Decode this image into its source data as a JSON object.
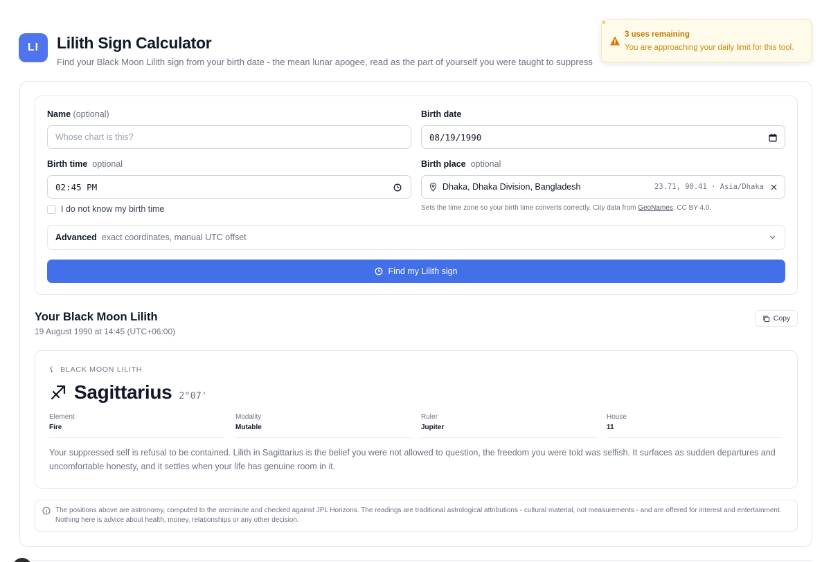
{
  "header": {
    "logo_text": "LI",
    "title": "Lilith Sign Calculator",
    "subtitle": "Find your Black Moon Lilith sign from your birth date - the mean lunar apogee, read as the part of yourself you were taught to suppress"
  },
  "toast": {
    "close": "×",
    "title": "3 uses remaining",
    "message": "You are approaching your daily limit for this tool.",
    "accent": "#d97706"
  },
  "form": {
    "name": {
      "label": "Name",
      "optional": "(optional)",
      "placeholder": "Whose chart is this?",
      "value": ""
    },
    "birth_date": {
      "label": "Birth date",
      "value": "08/19/1990"
    },
    "birth_time": {
      "label": "Birth time",
      "optional": "optional",
      "value": "02:45 PM"
    },
    "unknown_time": {
      "label": "I do not know my birth time",
      "checked": false
    },
    "birth_place": {
      "label": "Birth place",
      "optional": "optional",
      "value": "Dhaka, Dhaka Division, Bangladesh",
      "coords": "23.71, 90.41 · Asia/Dhaka",
      "hint_prefix": "Sets the time zone so your birth time converts correctly. City data from ",
      "hint_link": "GeoNames",
      "hint_suffix": ", CC BY 4.0."
    },
    "advanced": {
      "title": "Advanced",
      "subtitle": "exact coordinates, manual UTC offset"
    },
    "submit_label": "Find my Lilith sign",
    "accent": "#4370e8"
  },
  "result": {
    "title": "Your Black Moon Lilith",
    "subtitle": "19 August 1990 at 14:45 (UTC+06:00)",
    "copy_label": "Copy",
    "kicker": "BLACK MOON LILITH",
    "kicker_glyph": "⚸",
    "sign": "Sagittarius",
    "degree": "2°07'",
    "attributes": [
      {
        "key": "Element",
        "value": "Fire"
      },
      {
        "key": "Modality",
        "value": "Mutable"
      },
      {
        "key": "Ruler",
        "value": "Jupiter"
      },
      {
        "key": "House",
        "value": "11"
      }
    ],
    "description": "Your suppressed self is refusal to be contained. Lilith in Sagittarius is the belief you were not allowed to question, the freedom you were told was selfish. It surfaces as sudden departures and uncomfortable honesty, and it settles when your life has genuine room in it."
  },
  "disclaimer": "The positions above are astronomy, computed to the arcminute and checked against JPL Horizons. The readings are traditional astrological attributions - cultural material, not measurements - and are offered for interest and entertainment. Nothing here is advice about health, money, relationships or any other decision."
}
